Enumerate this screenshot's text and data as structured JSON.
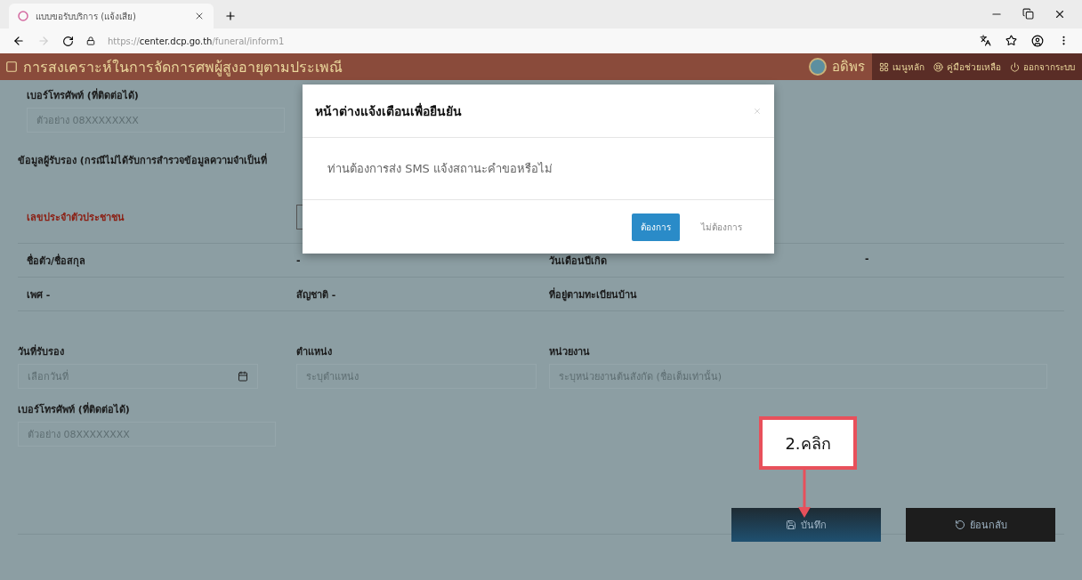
{
  "browser": {
    "tab": {
      "title": "แบบขอรับบริการ (แจ้งเสีย)",
      "selected": true
    },
    "address": {
      "scheme": "https://",
      "host": "center.dcp.go.th",
      "path": "/funeral/inform1"
    },
    "forward_disabled": true
  },
  "header": {
    "title": "การสงเคราะห์ในการจัดการศพผู้สูงอายุตามประเพณี",
    "user": "อดิพร",
    "menu": [
      {
        "kind": "grid",
        "label": "เมนูหลัก"
      },
      {
        "kind": "help",
        "label": "คู่มือช่วยเหลือ"
      },
      {
        "kind": "power",
        "label": "ออกจากระบบ"
      }
    ]
  },
  "form": {
    "phone_top": {
      "label": "เบอร์โทรศัพท์ (ที่ติดต่อได้)",
      "placeholder": "ตัวอย่าง 08XXXXXXXX"
    },
    "section_heading": "ข้อมูลผู้รับรอง (กรณีไม่ได้รับการสำรวจข้อมูลความจำเป็นที่",
    "citizen_id": {
      "label": "เลขประจำตัวประชาชน",
      "required": true
    },
    "info_rows": [
      [
        {
          "label": "ชื่อตัว/ชื่อสกุล",
          "value": "-"
        },
        {
          "label": "วันเดือนปีเกิด",
          "value": "-"
        }
      ],
      [
        {
          "label": "เพศ -"
        },
        {
          "label": "สัญชาติ -"
        },
        {
          "label": "ที่อยู่ตามทะเบียนบ้าน"
        }
      ]
    ],
    "fields": [
      {
        "kind": "date",
        "label": "วันที่รับรอง",
        "placeholder": "เลือกวันที่"
      },
      {
        "kind": "text",
        "label": "ตำแหน่ง",
        "placeholder": "ระบุตำแหน่ง"
      },
      {
        "kind": "text",
        "label": "หน่วยงาน",
        "placeholder": "ระบุหน่วยงานต้นสังกัด (ชื่อเต็มเท่านั้น)"
      }
    ],
    "phone_bottom": {
      "label": "เบอร์โทรศัพท์ (ที่ติดต่อได้)",
      "placeholder": "ตัวอย่าง 08XXXXXXXX"
    },
    "buttons": [
      {
        "kind": "save",
        "label": "บันทึก"
      },
      {
        "kind": "back",
        "label": "ย้อนกลับ"
      }
    ]
  },
  "modal": {
    "title": "หน้าต่างแจ้งเตือนเพื่อยืนยัน",
    "message": "ท่านต้องการส่ง SMS แจ้งสถานะคำขอหรือไม่",
    "buttons": [
      {
        "kind": "primary",
        "label": "ต้องการ"
      },
      {
        "kind": "link",
        "label": "ไม่ต้องการ"
      }
    ]
  },
  "annotation": {
    "text": "2.คลิก"
  }
}
